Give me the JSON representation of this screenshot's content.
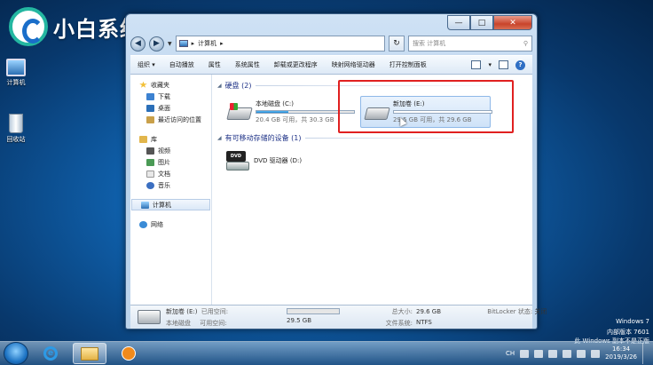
{
  "brand": {
    "text": "小白系统"
  },
  "desktop": {
    "icons": [
      {
        "label": "计算机",
        "icon": "computer-icon"
      },
      {
        "label": "回收站",
        "icon": "recycle-bin-icon"
      }
    ],
    "watermark": {
      "line1": "Windows 7",
      "line2": "内部版本 7601",
      "line3": "此 Windows 副本不是正版"
    }
  },
  "window": {
    "caption_buttons": [
      "—",
      "□",
      "✕"
    ],
    "address": {
      "separator": "▸",
      "path": "计算机",
      "tail": "▸"
    },
    "search": {
      "placeholder": "搜索 计算机"
    },
    "toolbar": {
      "items": [
        "组织 ▾",
        "自动播放",
        "属性",
        "系统属性",
        "卸载或更改程序",
        "映射网络驱动器",
        "打开控制面板"
      ],
      "view_label": "▾"
    },
    "nav": {
      "favorites": {
        "label": "收藏夹",
        "items": [
          "下载",
          "桌面",
          "最近访问的位置"
        ]
      },
      "libraries": {
        "label": "库",
        "items": [
          "视频",
          "图片",
          "文档",
          "音乐"
        ]
      },
      "computer": "计算机",
      "network": "网络"
    },
    "groups": {
      "hdd": "硬盘 (2)",
      "removable": "有可移动存储的设备 (1)"
    },
    "drives": [
      {
        "name": "本地磁盘 (C:)",
        "free": "20.4 GB 可用，共 30.3 GB",
        "used_fraction": 0.33
      },
      {
        "name": "新加卷 (E:)",
        "free": "29.5 GB 可用，共 29.6 GB",
        "used_fraction": 0.0
      }
    ],
    "dvd": {
      "name": "DVD 驱动器 (D:)"
    },
    "details": {
      "name": "新加卷 (E:)",
      "type": "本地磁盘",
      "used_label": "已用空间:",
      "free_label": "可用空间:",
      "free_value": "29.5 GB",
      "total_label": "总大小:",
      "total_value": "29.6 GB",
      "fs_label": "文件系统:",
      "fs_value": "NTFS",
      "bitlocker_label": "BitLocker 状态:",
      "bitlocker_value": "关闭"
    }
  },
  "taskbar": {
    "tray_lang": "CH",
    "time": "16:34",
    "date": "2019/3/26"
  }
}
